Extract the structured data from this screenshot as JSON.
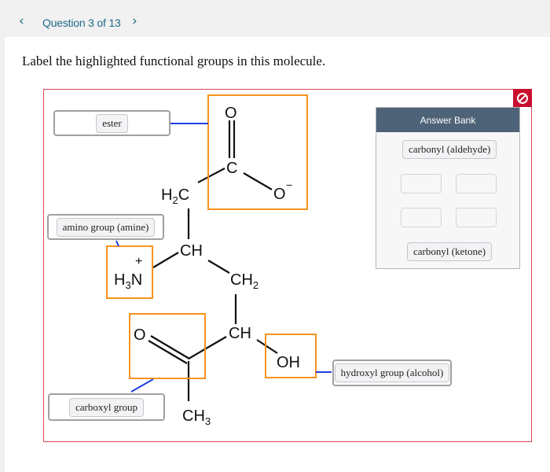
{
  "nav": {
    "prev_icon": "chevron-left-icon",
    "prev_glyph": "‹",
    "title": "Question 3 of 13",
    "next_icon": "chevron-right-icon",
    "next_glyph": "›"
  },
  "prompt": "Label the highlighted functional groups in this molecule.",
  "colors": {
    "accent": "#1f6b8a",
    "highlight_box": "#f7931e",
    "connector": "#1f3fe0",
    "border_error": "#d9475a",
    "clear_button": "#c8102e",
    "bank_header": "#4e6378"
  },
  "molecule": {
    "atoms": {
      "o_top": "O",
      "c_carboxylate": "C",
      "o_minus": "O",
      "o_minus_charge": "−",
      "h2c": "H",
      "h2c_sub": "2",
      "h2c_c": "C",
      "ch_upper": "CH",
      "h3n_h": "H",
      "h3n_sub": "3",
      "h3n_n": "N",
      "h3n_charge": "+",
      "ch2": "CH",
      "ch2_sub": "2",
      "ch_lower": "CH",
      "oh": "OH",
      "o_ketone": "O",
      "ch3": "CH",
      "ch3_sub": "3"
    }
  },
  "targets": [
    {
      "id": "carboxylate",
      "label": "ester"
    },
    {
      "id": "amine",
      "label": "amino group (amine)"
    },
    {
      "id": "ketone",
      "label": "carboxyl group"
    },
    {
      "id": "hydroxyl",
      "label": "hydroxyl group (alcohol)"
    }
  ],
  "answer_bank": {
    "title": "Answer Bank",
    "items": [
      "carbonyl (aldehyde)",
      "carbonyl (ketone)"
    ],
    "empty_slots": 4
  },
  "clear_icon": "no-entry-icon"
}
